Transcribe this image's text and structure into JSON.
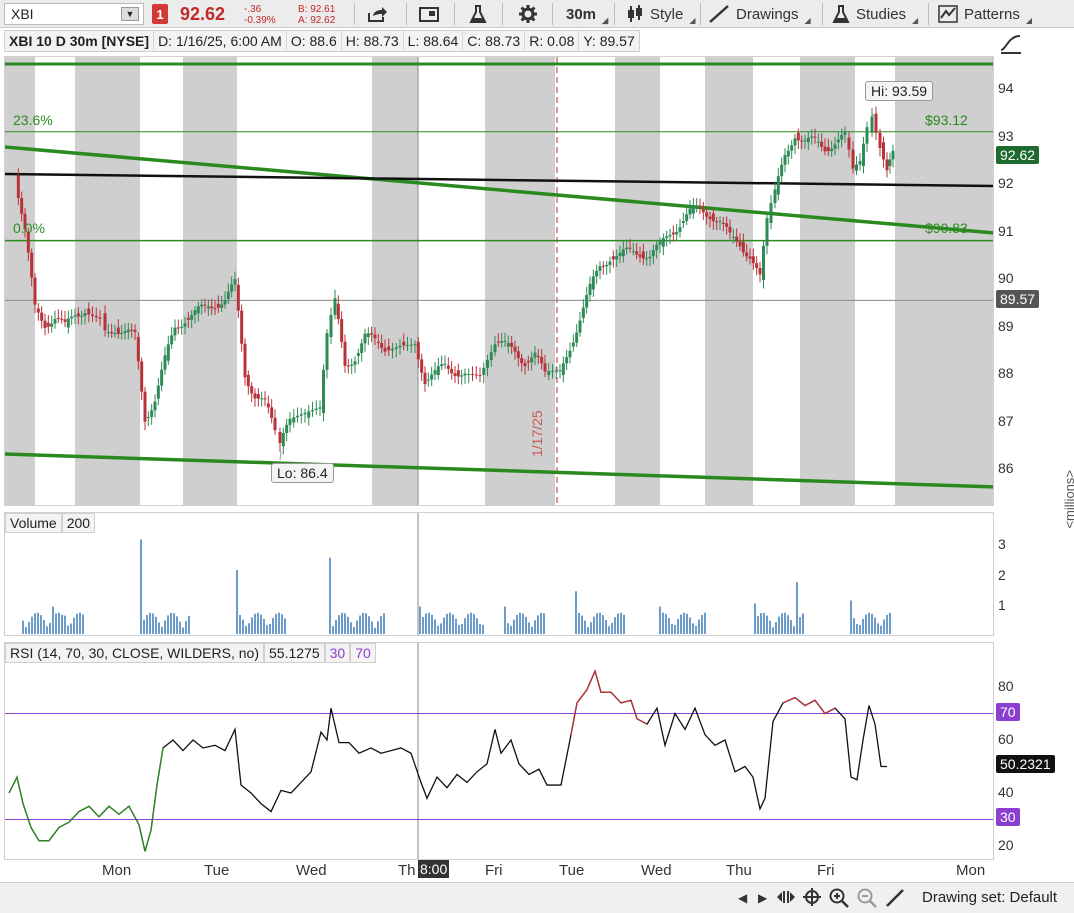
{
  "toolbar": {
    "symbol": "XBI",
    "alert_count": "1",
    "last_price": "92.62",
    "change": "-.36",
    "change_pct": "-0.39%",
    "bid": "B: 92.61",
    "ask": "A: 92.62",
    "timeframe": "30m",
    "style_label": "Style",
    "drawings_label": "Drawings",
    "studies_label": "Studies",
    "patterns_label": "Patterns"
  },
  "header": {
    "title": "XBI 10 D 30m [NYSE]",
    "date": "D: 1/16/25, 6:00 AM",
    "open": "O: 88.6",
    "high": "H: 88.73",
    "low": "L: 88.64",
    "close": "C: 88.73",
    "range": "R: 0.08",
    "y": "Y: 89.57"
  },
  "price_chart": {
    "y_ticks": [
      "94",
      "93",
      "92",
      "91",
      "90",
      "89",
      "88",
      "87",
      "86"
    ],
    "last_price_tag": "92.62",
    "crosshair_tag": "89.57",
    "fib_top_label": "23.6%",
    "fib_top_price": "$93.12",
    "fib_bottom_label": "0.0%",
    "fib_bottom_price": "$90.83",
    "hi_label": "Hi: 93.59",
    "lo_label": "Lo: 86.4",
    "vertical_date_label": "1/17/25",
    "colors": {
      "up": "#2e8b57",
      "down": "#b8323a",
      "trend": "#2a8a1f",
      "shade": "#cfcfcf"
    }
  },
  "volume": {
    "label": "Volume",
    "value": "200",
    "y_ticks": [
      "3",
      "2",
      "1"
    ],
    "unit": "<millions>"
  },
  "rsi": {
    "label": "RSI (14, 70, 30, CLOSE, WILDERS, no)",
    "value": "55.1275",
    "ob": "30",
    "os": "70",
    "y_ticks": [
      "80",
      "60",
      "40",
      "20"
    ],
    "tag_70": "70",
    "tag_30": "30",
    "tag_value": "50.2321"
  },
  "time_axis": {
    "labels": [
      "Mon",
      "Tue",
      "Wed",
      "Th",
      "Fri",
      "Tue",
      "Wed",
      "Thu",
      "Fri",
      "Mon"
    ],
    "crosshair_time": "8:00"
  },
  "bottom": {
    "drawing_set": "Drawing set: Default"
  }
}
